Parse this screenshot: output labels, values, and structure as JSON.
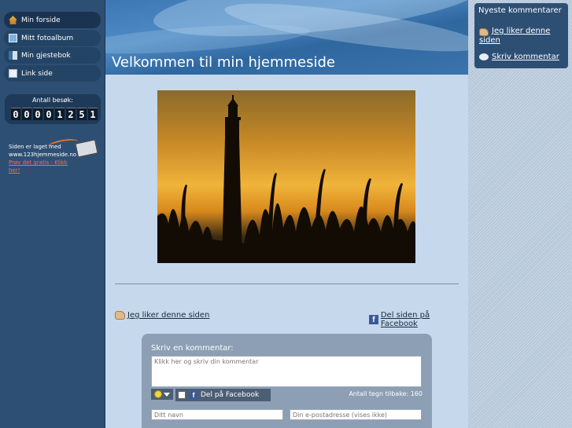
{
  "sidebar": {
    "items": [
      {
        "label": "Min forside",
        "icon": "home-icon"
      },
      {
        "label": "Mitt fotoalbum",
        "icon": "photo-album-icon"
      },
      {
        "label": "Min gjestebok",
        "icon": "guestbook-icon"
      },
      {
        "label": "Link side",
        "icon": "page-icon"
      }
    ],
    "counter": {
      "label": "Antall besøk:",
      "digits": [
        "0",
        "0",
        "0",
        "0",
        "1",
        "2",
        "5",
        "1"
      ]
    },
    "made_with": {
      "line1": "Siden er laget med",
      "line2": "www.123hjemmeside.no",
      "link": "Prøv det gratis - Klikk her!"
    }
  },
  "header": {
    "title": "Velkommen til min hjemmeside"
  },
  "main": {
    "like_label": "Jeg liker denne siden",
    "share_label": "Del siden på Facebook",
    "comment": {
      "title": "Skriv en kommentar:",
      "placeholder": "Klikk her og skriv din kommentar",
      "facebook_label": "Del på Facebook",
      "char_count": "Antall tegn tilbake: 160",
      "name_placeholder": "Ditt navn",
      "email_placeholder": "Din e-postadresse (vises ikke)"
    }
  },
  "right": {
    "title": "Nyeste kommentarer",
    "like_label": "Jeg liker denne siden",
    "comment_label": "Skriv kommentar"
  },
  "colors": {
    "sidebar": "#2e4f74",
    "content": "#c6d8ec",
    "banner": "#3c77b4",
    "link_red": "#ff6a56"
  }
}
